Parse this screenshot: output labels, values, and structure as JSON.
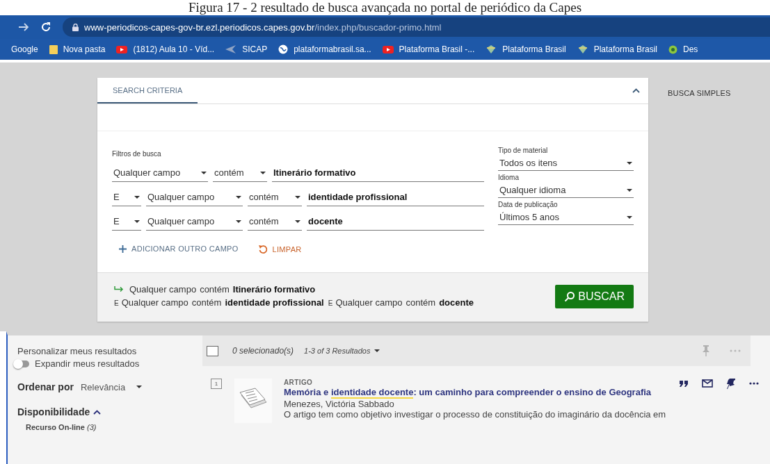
{
  "caption": "Figura 17 - 2 resultado de busca avançada no portal de periódico da Capes",
  "browser": {
    "url_host": "www-periodicos-capes-gov-br.ezl.periodicos.capes.gov.br",
    "url_path": "/index.php/buscador-primo.html",
    "bookmarks": [
      {
        "kind": "none",
        "label": "Google"
      },
      {
        "kind": "folder",
        "label": "Nova pasta"
      },
      {
        "kind": "video",
        "label": "(1812) Aula 10 - Víd..."
      },
      {
        "kind": "sicap",
        "label": "SICAP"
      },
      {
        "kind": "globe",
        "label": "plataformabrasil.sa..."
      },
      {
        "kind": "video",
        "label": "Plataforma Brasil -..."
      },
      {
        "kind": "gem",
        "label": "Plataforma Brasil"
      },
      {
        "kind": "gem",
        "label": "Plataforma Brasil"
      },
      {
        "kind": "ball",
        "label": "Des"
      }
    ]
  },
  "search": {
    "tabs": [
      {
        "label": "SEARCH CRITERIA",
        "selected": true
      }
    ],
    "filters_label": "Filtros de busca",
    "rows": [
      {
        "field": "Qualquer campo",
        "condition": "contém",
        "value": "Itinerário formativo"
      },
      {
        "operator": "E",
        "field": "Qualquer campo",
        "condition": "contém",
        "value": "identidade profissional"
      },
      {
        "operator": "E",
        "field": "Qualquer campo",
        "condition": "contém",
        "value": "docente"
      }
    ],
    "options": [
      {
        "label": "Tipo de material",
        "value": "Todos os itens"
      },
      {
        "label": "Idioma",
        "value": "Qualquer idioma"
      },
      {
        "label": "Data de publicação",
        "value": "Últimos 5 anos"
      }
    ],
    "add_field": "ADICIONAR OUTRO CAMPO",
    "clear": "LIMPAR",
    "summary": [
      {
        "field": "Qualquer campo",
        "condition": "contém",
        "value": "Itinerário formativo"
      },
      {
        "operator": "E",
        "field": "Qualquer campo",
        "condition": "contém",
        "value": "identidade profissional"
      },
      {
        "operator": "E",
        "field": "Qualquer campo",
        "condition": "contém",
        "value": "docente"
      }
    ],
    "search_button": "BUSCAR"
  },
  "simple_search": "BUSCA SIMPLES",
  "sidebar": {
    "personalize": "Personalizar meus resultados",
    "expand": {
      "label": "Expandir meus resultados",
      "on": false
    },
    "sort_label": "Ordenar por",
    "sort_value": "Relevância",
    "availability": {
      "label": "Disponibilidade",
      "expanded": true
    },
    "facets": [
      {
        "label": "Recurso On-line",
        "count": "(3)"
      }
    ]
  },
  "results": {
    "select_all": {
      "checked": false
    },
    "selected_count": "0 selecionado(s)",
    "range": "1-3 of 3 Resultados",
    "items": [
      {
        "number": "1",
        "type": "ARTIGO",
        "title": [
          {
            "text": "Memória e ",
            "highlight": false
          },
          {
            "text": "identidade docente",
            "highlight": true
          },
          {
            "text": ": um caminho para compreender o ensino de Geografia",
            "highlight": false
          }
        ],
        "author": "Menezes, Victória Sabbado",
        "abstract": "O artigo tem como objetivo investigar o processo de constituição do imaginário da docência em"
      }
    ]
  }
}
